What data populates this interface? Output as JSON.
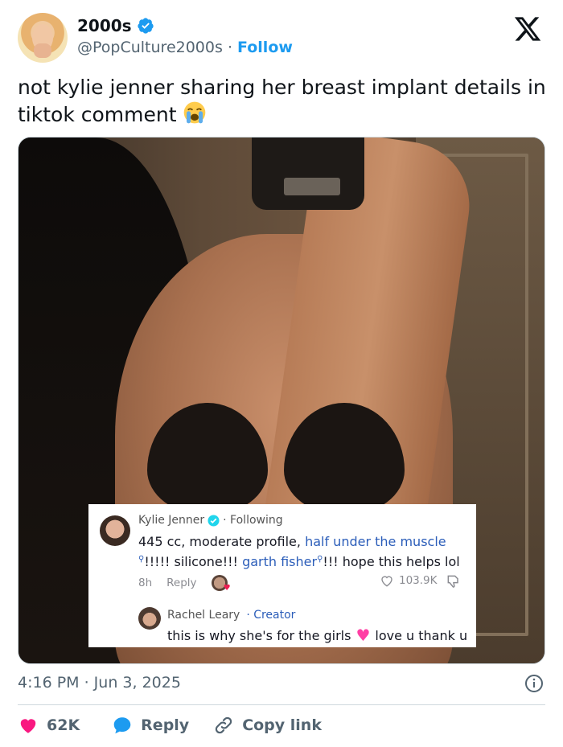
{
  "author": {
    "name": "2000s",
    "handle": "@PopCulture2000s",
    "separator": "·",
    "follow_label": "Follow"
  },
  "tweet": {
    "text": "not kylie jenner sharing her breast implant details in tiktok comment",
    "emoji": "loudly-crying-face"
  },
  "comment_overlay": {
    "main": {
      "name": "Kylie Jenner",
      "status": "· Following",
      "text_part1": "445 cc, moderate profile, ",
      "link1": "half under the muscle",
      "text_part2": "!!!!! silicone!!! ",
      "link2": "garth fisher",
      "text_part3": "!!! hope this helps lol",
      "time": "8h",
      "reply_label": "Reply",
      "likes": "103.9K"
    },
    "reply": {
      "name": "Rachel Leary",
      "badge": "· Creator",
      "text_before": "this is why she's for the girls",
      "text_after": "love u thank u"
    }
  },
  "footer": {
    "timestamp": "4:16 PM · Jun 3, 2025",
    "like_count": "62K",
    "reply_label": "Reply",
    "copy_label": "Copy link"
  },
  "colors": {
    "blue": "#1d9bf0",
    "like_red": "#f91880",
    "text": "#0f1419",
    "muted": "#536471"
  }
}
